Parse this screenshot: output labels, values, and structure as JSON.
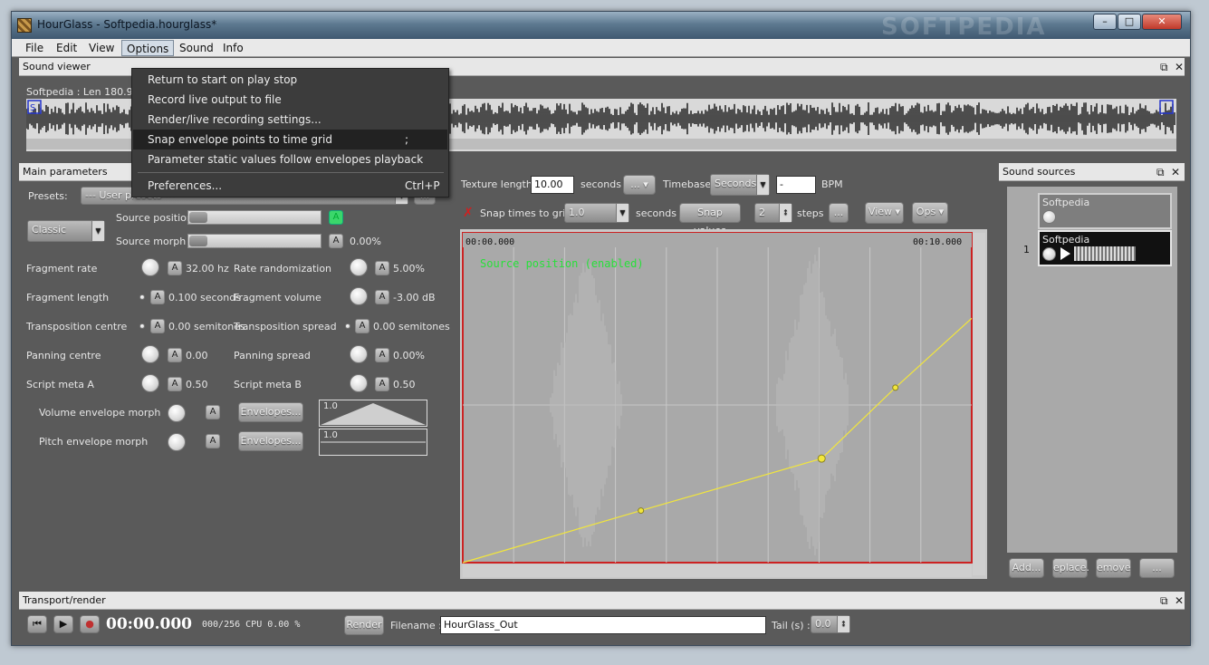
{
  "window": {
    "title": "HourGlass - Softpedia.hourglass*"
  },
  "menu": [
    "File",
    "Edit",
    "View",
    "Options",
    "Sound",
    "Info"
  ],
  "dropdown": {
    "items": [
      {
        "label": "Return to start on play stop",
        "shortcut": ""
      },
      {
        "label": "Record live output to file",
        "shortcut": ""
      },
      {
        "label": "Render/live recording settings...",
        "shortcut": ""
      },
      {
        "label": "Snap envelope points to time grid",
        "shortcut": ";"
      },
      {
        "label": "Parameter static values follow envelopes playback",
        "shortcut": ""
      },
      {
        "label": "Preferences...",
        "shortcut": "Ctrl+P"
      }
    ]
  },
  "sound_viewer": {
    "title": "Sound viewer",
    "info": "Softpedia : Len 180.9",
    "marker_s": "S"
  },
  "main_params": {
    "title": "Main parameters",
    "presets_label": "Presets:",
    "presets_value": "--- User presets ---",
    "presets_more": "...",
    "mode": "Classic",
    "source_position": "Source position",
    "source_morph": "Source morph",
    "source_morph_value": "0.00%",
    "a": "A",
    "rows": [
      {
        "l_label": "Fragment rate",
        "l_value": "32.00 hz",
        "r_label": "Rate randomization",
        "r_value": "5.00%"
      },
      {
        "l_label": "Fragment length",
        "l_value": "0.100 seconds",
        "r_label": "Fragment volume",
        "r_value": "-3.00 dB"
      },
      {
        "l_label": "Transposition centre",
        "l_value": "0.00 semitones",
        "r_label": "Transposition spread",
        "r_value": "0.00 semitones"
      },
      {
        "l_label": "Panning centre",
        "l_value": "0.00",
        "r_label": "Panning spread",
        "r_value": "0.00%"
      },
      {
        "l_label": "Script meta A",
        "l_value": "0.50",
        "r_label": "Script meta B",
        "r_value": "0.50"
      }
    ],
    "volume_env": "Volume envelope morph",
    "pitch_env": "Pitch envelope morph",
    "envelopes_btn": "Envelopes...",
    "env_value": "1.0"
  },
  "envelope_editor": {
    "texture_length_label": "Texture length",
    "texture_length": "10.00",
    "seconds": "seconds",
    "combo_dots": "...",
    "timebase_label": "Timebase",
    "timebase": "Seconds",
    "bpm_value": "-",
    "bpm": "BPM",
    "snap_label": "Snap times to grid",
    "snap_value": "1.0",
    "snap_values_btn": "Snap values",
    "steps_value": "2",
    "steps": "steps",
    "more": "...",
    "view_btn": "View",
    "ops_btn": "Ops",
    "time_start": "00:00.000",
    "time_end": "00:10.000",
    "overlay": "Source position (enabled)",
    "envelope_color": "#f2e63c",
    "env_points": [
      [
        0,
        0
      ],
      [
        0.35,
        0.165
      ],
      [
        0.705,
        0.33
      ],
      [
        0.85,
        0.555
      ],
      [
        1,
        0.775
      ]
    ]
  },
  "sound_sources": {
    "title": "Sound sources",
    "items": [
      {
        "name": "Softpedia",
        "index": ""
      },
      {
        "name": "Softpedia",
        "index": "1"
      }
    ],
    "buttons": [
      "Add...",
      "eplace.",
      "emove",
      "..."
    ]
  },
  "transport": {
    "title": "Transport/render",
    "time": "00:00.000",
    "status": "000/256 CPU 0.00 %",
    "render_btn": "Render",
    "filename_label": "Filename :",
    "filename": "HourGlass_Out",
    "tail_label": "Tail (s) :",
    "tail_value": "0.0"
  },
  "watermark": "SOFTPEDIA"
}
